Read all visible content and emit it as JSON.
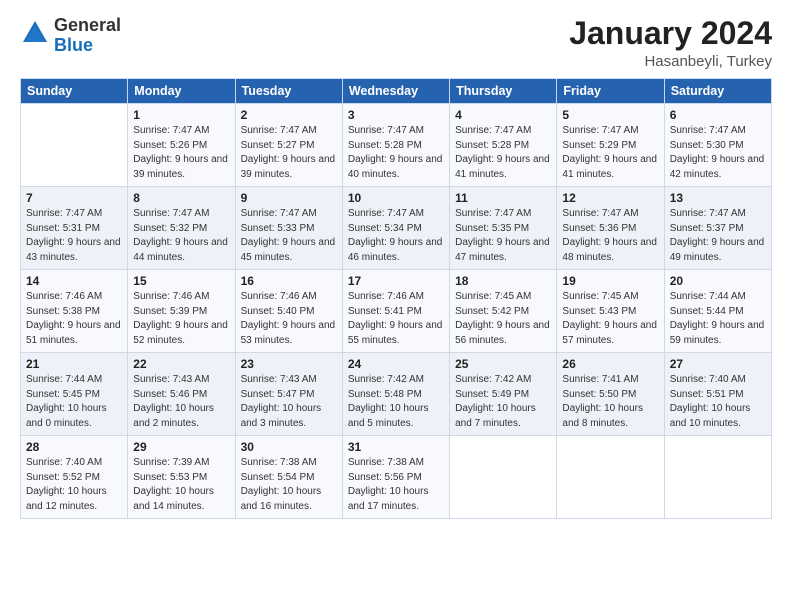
{
  "logo": {
    "general": "General",
    "blue": "Blue"
  },
  "title": {
    "month": "January 2024",
    "location": "Hasanbeyli, Turkey"
  },
  "headers": [
    "Sunday",
    "Monday",
    "Tuesday",
    "Wednesday",
    "Thursday",
    "Friday",
    "Saturday"
  ],
  "weeks": [
    [
      {
        "day": "",
        "sunrise": "",
        "sunset": "",
        "daylight": ""
      },
      {
        "day": "1",
        "sunrise": "Sunrise: 7:47 AM",
        "sunset": "Sunset: 5:26 PM",
        "daylight": "Daylight: 9 hours and 39 minutes."
      },
      {
        "day": "2",
        "sunrise": "Sunrise: 7:47 AM",
        "sunset": "Sunset: 5:27 PM",
        "daylight": "Daylight: 9 hours and 39 minutes."
      },
      {
        "day": "3",
        "sunrise": "Sunrise: 7:47 AM",
        "sunset": "Sunset: 5:28 PM",
        "daylight": "Daylight: 9 hours and 40 minutes."
      },
      {
        "day": "4",
        "sunrise": "Sunrise: 7:47 AM",
        "sunset": "Sunset: 5:28 PM",
        "daylight": "Daylight: 9 hours and 41 minutes."
      },
      {
        "day": "5",
        "sunrise": "Sunrise: 7:47 AM",
        "sunset": "Sunset: 5:29 PM",
        "daylight": "Daylight: 9 hours and 41 minutes."
      },
      {
        "day": "6",
        "sunrise": "Sunrise: 7:47 AM",
        "sunset": "Sunset: 5:30 PM",
        "daylight": "Daylight: 9 hours and 42 minutes."
      }
    ],
    [
      {
        "day": "7",
        "sunrise": "Sunrise: 7:47 AM",
        "sunset": "Sunset: 5:31 PM",
        "daylight": "Daylight: 9 hours and 43 minutes."
      },
      {
        "day": "8",
        "sunrise": "Sunrise: 7:47 AM",
        "sunset": "Sunset: 5:32 PM",
        "daylight": "Daylight: 9 hours and 44 minutes."
      },
      {
        "day": "9",
        "sunrise": "Sunrise: 7:47 AM",
        "sunset": "Sunset: 5:33 PM",
        "daylight": "Daylight: 9 hours and 45 minutes."
      },
      {
        "day": "10",
        "sunrise": "Sunrise: 7:47 AM",
        "sunset": "Sunset: 5:34 PM",
        "daylight": "Daylight: 9 hours and 46 minutes."
      },
      {
        "day": "11",
        "sunrise": "Sunrise: 7:47 AM",
        "sunset": "Sunset: 5:35 PM",
        "daylight": "Daylight: 9 hours and 47 minutes."
      },
      {
        "day": "12",
        "sunrise": "Sunrise: 7:47 AM",
        "sunset": "Sunset: 5:36 PM",
        "daylight": "Daylight: 9 hours and 48 minutes."
      },
      {
        "day": "13",
        "sunrise": "Sunrise: 7:47 AM",
        "sunset": "Sunset: 5:37 PM",
        "daylight": "Daylight: 9 hours and 49 minutes."
      }
    ],
    [
      {
        "day": "14",
        "sunrise": "Sunrise: 7:46 AM",
        "sunset": "Sunset: 5:38 PM",
        "daylight": "Daylight: 9 hours and 51 minutes."
      },
      {
        "day": "15",
        "sunrise": "Sunrise: 7:46 AM",
        "sunset": "Sunset: 5:39 PM",
        "daylight": "Daylight: 9 hours and 52 minutes."
      },
      {
        "day": "16",
        "sunrise": "Sunrise: 7:46 AM",
        "sunset": "Sunset: 5:40 PM",
        "daylight": "Daylight: 9 hours and 53 minutes."
      },
      {
        "day": "17",
        "sunrise": "Sunrise: 7:46 AM",
        "sunset": "Sunset: 5:41 PM",
        "daylight": "Daylight: 9 hours and 55 minutes."
      },
      {
        "day": "18",
        "sunrise": "Sunrise: 7:45 AM",
        "sunset": "Sunset: 5:42 PM",
        "daylight": "Daylight: 9 hours and 56 minutes."
      },
      {
        "day": "19",
        "sunrise": "Sunrise: 7:45 AM",
        "sunset": "Sunset: 5:43 PM",
        "daylight": "Daylight: 9 hours and 57 minutes."
      },
      {
        "day": "20",
        "sunrise": "Sunrise: 7:44 AM",
        "sunset": "Sunset: 5:44 PM",
        "daylight": "Daylight: 9 hours and 59 minutes."
      }
    ],
    [
      {
        "day": "21",
        "sunrise": "Sunrise: 7:44 AM",
        "sunset": "Sunset: 5:45 PM",
        "daylight": "Daylight: 10 hours and 0 minutes."
      },
      {
        "day": "22",
        "sunrise": "Sunrise: 7:43 AM",
        "sunset": "Sunset: 5:46 PM",
        "daylight": "Daylight: 10 hours and 2 minutes."
      },
      {
        "day": "23",
        "sunrise": "Sunrise: 7:43 AM",
        "sunset": "Sunset: 5:47 PM",
        "daylight": "Daylight: 10 hours and 3 minutes."
      },
      {
        "day": "24",
        "sunrise": "Sunrise: 7:42 AM",
        "sunset": "Sunset: 5:48 PM",
        "daylight": "Daylight: 10 hours and 5 minutes."
      },
      {
        "day": "25",
        "sunrise": "Sunrise: 7:42 AM",
        "sunset": "Sunset: 5:49 PM",
        "daylight": "Daylight: 10 hours and 7 minutes."
      },
      {
        "day": "26",
        "sunrise": "Sunrise: 7:41 AM",
        "sunset": "Sunset: 5:50 PM",
        "daylight": "Daylight: 10 hours and 8 minutes."
      },
      {
        "day": "27",
        "sunrise": "Sunrise: 7:40 AM",
        "sunset": "Sunset: 5:51 PM",
        "daylight": "Daylight: 10 hours and 10 minutes."
      }
    ],
    [
      {
        "day": "28",
        "sunrise": "Sunrise: 7:40 AM",
        "sunset": "Sunset: 5:52 PM",
        "daylight": "Daylight: 10 hours and 12 minutes."
      },
      {
        "day": "29",
        "sunrise": "Sunrise: 7:39 AM",
        "sunset": "Sunset: 5:53 PM",
        "daylight": "Daylight: 10 hours and 14 minutes."
      },
      {
        "day": "30",
        "sunrise": "Sunrise: 7:38 AM",
        "sunset": "Sunset: 5:54 PM",
        "daylight": "Daylight: 10 hours and 16 minutes."
      },
      {
        "day": "31",
        "sunrise": "Sunrise: 7:38 AM",
        "sunset": "Sunset: 5:56 PM",
        "daylight": "Daylight: 10 hours and 17 minutes."
      },
      {
        "day": "",
        "sunrise": "",
        "sunset": "",
        "daylight": ""
      },
      {
        "day": "",
        "sunrise": "",
        "sunset": "",
        "daylight": ""
      },
      {
        "day": "",
        "sunrise": "",
        "sunset": "",
        "daylight": ""
      }
    ]
  ]
}
